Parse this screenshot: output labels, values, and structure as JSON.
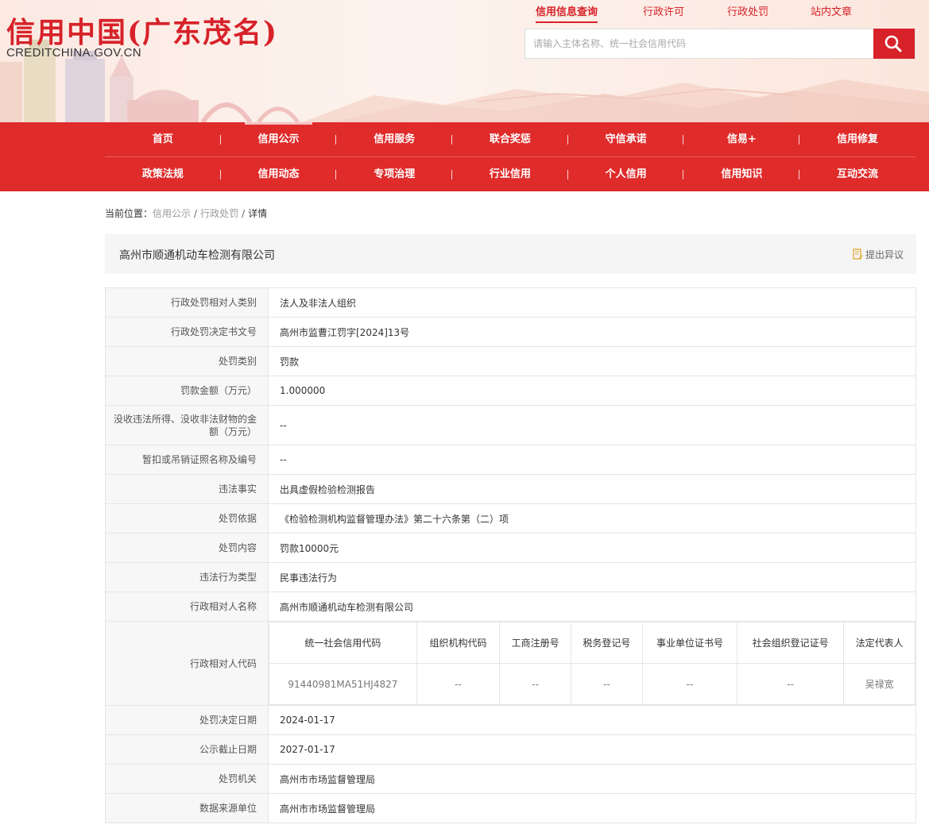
{
  "header": {
    "logo_title": "信用中国(广东茂名)",
    "logo_sub": "CREDITCHINA.GOV.CN",
    "top_links": [
      "信用信息查询",
      "行政许可",
      "行政处罚",
      "站内文章"
    ],
    "search_placeholder": "请输入主体名称、统一社会信用代码"
  },
  "nav": {
    "row1": [
      "首页",
      "信用公示",
      "信用服务",
      "联合奖惩",
      "守信承诺",
      "信易+",
      "信用修复"
    ],
    "row2": [
      "政策法规",
      "信用动态",
      "专项治理",
      "行业信用",
      "个人信用",
      "信用知识",
      "互动交流"
    ]
  },
  "breadcrumb": {
    "label": "当前位置：",
    "items": [
      "信用公示",
      "行政处罚",
      "详情"
    ]
  },
  "title_bar": {
    "company": "高州市顺通机动车检测有限公司",
    "objection": "提出异议"
  },
  "details": [
    {
      "label": "行政处罚相对人类别",
      "value": "法人及非法人组织"
    },
    {
      "label": "行政处罚决定书文号",
      "value": "高州市监曹江罚字[2024]13号"
    },
    {
      "label": "处罚类别",
      "value": "罚款"
    },
    {
      "label": "罚款金额（万元）",
      "value": "1.000000"
    },
    {
      "label": "没收违法所得、没收非法财物的金额（万元）",
      "value": "--"
    },
    {
      "label": "暂扣或吊销证照名称及编号",
      "value": "--"
    },
    {
      "label": "违法事实",
      "value": "出具虚假检验检测报告"
    },
    {
      "label": "处罚依据",
      "value": "《检验检测机构监督管理办法》第二十六条第（二）项"
    },
    {
      "label": "处罚内容",
      "value": "罚款10000元"
    },
    {
      "label": "违法行为类型",
      "value": "民事违法行为"
    },
    {
      "label": "行政相对人名称",
      "value": "高州市顺通机动车检测有限公司"
    }
  ],
  "code_row": {
    "label": "行政相对人代码",
    "headers": [
      "统一社会信用代码",
      "组织机构代码",
      "工商注册号",
      "税务登记号",
      "事业单位证书号",
      "社会组织登记证号",
      "法定代表人"
    ],
    "values": [
      "91440981MA51HJ4827",
      "--",
      "--",
      "--",
      "--",
      "--",
      "吴禄宽"
    ]
  },
  "details_after": [
    {
      "label": "处罚决定日期",
      "value": "2024-01-17"
    },
    {
      "label": "公示截止日期",
      "value": "2027-01-17"
    },
    {
      "label": "处罚机关",
      "value": "高州市市场监督管理局"
    },
    {
      "label": "数据来源单位",
      "value": "高州市市场监督管理局"
    }
  ],
  "colors": {
    "brand_red": "#e02b2b",
    "title_red": "#d7222a"
  }
}
